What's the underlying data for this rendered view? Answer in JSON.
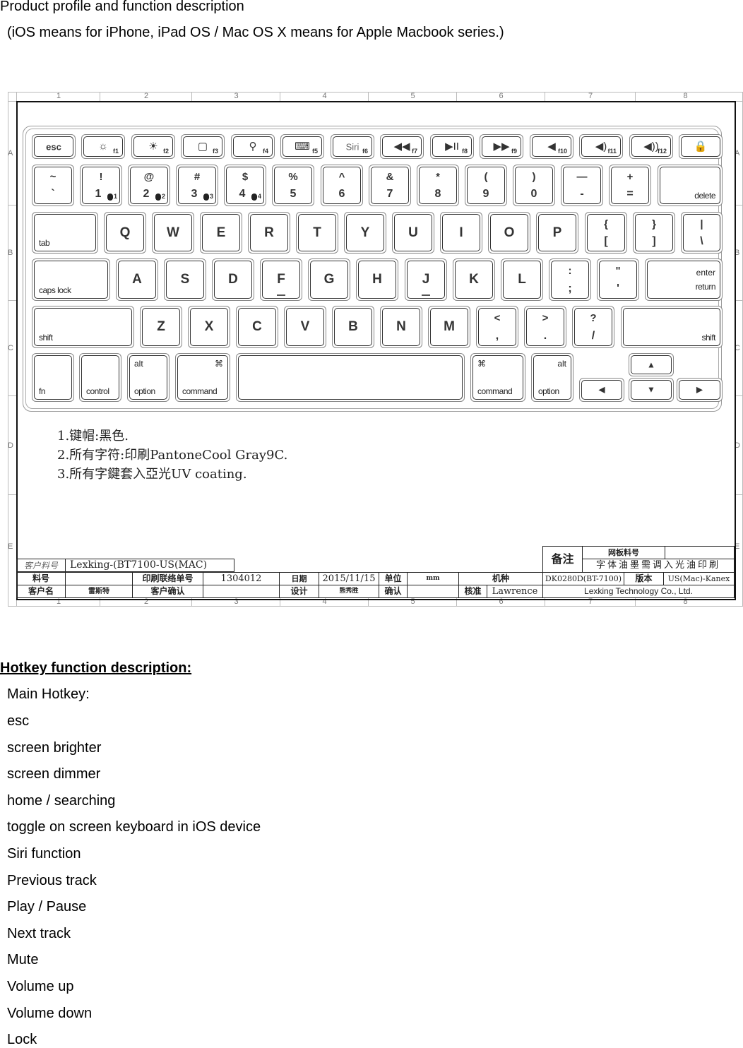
{
  "header": {
    "title": "Product profile and function description",
    "subtitle": "(iOS means for iPhone, iPad OS / Mac OS X means for Apple Macbook series.)"
  },
  "drawing": {
    "ruler_columns": [
      "1",
      "2",
      "3",
      "4",
      "5",
      "6",
      "7",
      "8"
    ],
    "ruler_rows": [
      "A",
      "B",
      "C",
      "D",
      "E"
    ],
    "keyboard": {
      "row1": [
        {
          "label": "esc"
        },
        {
          "icon": "brightness-down-icon",
          "glyph": "☼",
          "fn": "f1"
        },
        {
          "icon": "brightness-up-icon",
          "glyph": "☀",
          "fn": "f2"
        },
        {
          "icon": "home-square-icon",
          "glyph": "▢",
          "fn": "f3"
        },
        {
          "icon": "search-icon",
          "glyph": "⚲",
          "fn": "f4"
        },
        {
          "icon": "keyboard-icon",
          "glyph": "⌨",
          "fn": "f5"
        },
        {
          "label": "Siri",
          "fn": "f6"
        },
        {
          "icon": "previous-track-icon",
          "glyph": "◀◀",
          "fn": "f7"
        },
        {
          "icon": "play-pause-icon",
          "glyph": "▶II",
          "fn": "f8"
        },
        {
          "icon": "next-track-icon",
          "glyph": "▶▶",
          "fn": "f9"
        },
        {
          "icon": "mute-icon",
          "glyph": "◀",
          "fn": "f10"
        },
        {
          "icon": "volume-down-icon",
          "glyph": "◀)",
          "fn": "f11"
        },
        {
          "icon": "volume-up-icon",
          "glyph": "◀))",
          "fn": "f12"
        },
        {
          "icon": "lock-icon",
          "glyph": "🔒"
        }
      ],
      "row2": [
        {
          "top": "~",
          "bot": "`"
        },
        {
          "top": "!",
          "bot": "1",
          "badge": "1"
        },
        {
          "top": "@",
          "bot": "2",
          "badge": "2"
        },
        {
          "top": "#",
          "bot": "3",
          "badge": "3"
        },
        {
          "top": "$",
          "bot": "4",
          "badge": "4"
        },
        {
          "top": "%",
          "bot": "5"
        },
        {
          "top": "^",
          "bot": "6"
        },
        {
          "top": "&",
          "bot": "7"
        },
        {
          "top": "*",
          "bot": "8"
        },
        {
          "top": "(",
          "bot": "9"
        },
        {
          "top": ")",
          "bot": "0"
        },
        {
          "top": "—",
          "bot": "-"
        },
        {
          "top": "+",
          "bot": "="
        },
        {
          "br": "delete"
        }
      ],
      "row3": [
        {
          "bl": "tab"
        },
        {
          "c": "Q"
        },
        {
          "c": "W"
        },
        {
          "c": "E"
        },
        {
          "c": "R"
        },
        {
          "c": "T"
        },
        {
          "c": "Y"
        },
        {
          "c": "U"
        },
        {
          "c": "I"
        },
        {
          "c": "O"
        },
        {
          "c": "P"
        },
        {
          "top": "{",
          "bot": "["
        },
        {
          "top": "}",
          "bot": "]"
        },
        {
          "top": "|",
          "bot": "\\"
        }
      ],
      "row4": [
        {
          "bl": "caps lock"
        },
        {
          "c": "A"
        },
        {
          "c": "S"
        },
        {
          "c": "D"
        },
        {
          "c": "F",
          "home": true
        },
        {
          "c": "G"
        },
        {
          "c": "H"
        },
        {
          "c": "J",
          "home": true
        },
        {
          "c": "K"
        },
        {
          "c": "L"
        },
        {
          "top": ":",
          "bot": ";"
        },
        {
          "top": "\"",
          "bot": "'"
        },
        {
          "tr2": "enter",
          "br": "return"
        }
      ],
      "row5": [
        {
          "bl": "shift"
        },
        {
          "c": "Z"
        },
        {
          "c": "X"
        },
        {
          "c": "C"
        },
        {
          "c": "V"
        },
        {
          "c": "B"
        },
        {
          "c": "N"
        },
        {
          "c": "M"
        },
        {
          "top": "<",
          "bot": ","
        },
        {
          "top": ">",
          "bot": "."
        },
        {
          "top": "?",
          "bot": "/"
        },
        {
          "br": "shift"
        }
      ],
      "row6": [
        {
          "bl": "fn"
        },
        {
          "bl": "control"
        },
        {
          "tl": "alt",
          "bl": "option"
        },
        {
          "tr": "⌘",
          "bl": "command"
        },
        {
          "space": true
        },
        {
          "tl": "⌘",
          "bl": "command"
        },
        {
          "tr": "alt",
          "bl": "option"
        },
        {
          "icon": "arrow-left-icon",
          "glyph": "◀"
        },
        {
          "icon": "arrow-up-icon",
          "glyph": "▲"
        },
        {
          "icon": "arrow-down-icon",
          "glyph": "▼"
        },
        {
          "icon": "arrow-right-icon",
          "glyph": "▶"
        }
      ]
    },
    "notes": [
      "1.键帽:黑色.",
      "2.所有字符:印刷PantoneCool Gray9C.",
      "3.所有字鍵套入亞光UV coating."
    ],
    "title_block": {
      "customer_part_label": "客户料号",
      "customer_part_value": "Lexking-(BT7100-US(MAC)",
      "part_no_label": "料号",
      "part_no_value": "",
      "print_order_label": "印刷联络单号",
      "print_order_value": "1304012",
      "date_label": "日期",
      "date_value": "2015/11/15",
      "unit_label": "单位",
      "unit_value": "mm",
      "model_label": "机种",
      "model_value": "DK0280D(BT-7100)",
      "version_label": "版本",
      "version_value": "US(Mac)-Kanex",
      "customer_name_label": "客户名",
      "customer_name_value": "雷斯特",
      "customer_confirm_label": "客户确认",
      "customer_confirm_value": "",
      "design_label": "设计",
      "design_value": "熊秀胜",
      "confirm_label": "确认",
      "confirm_value": "",
      "approve_label": "核准",
      "approve_value": "Lawrence",
      "remarks_label": "备注",
      "screen_part_label": "网板料号",
      "screen_part_value": "",
      "remarks_value": "字体油墨需调入光油印刷",
      "company": "Lexking Technology Co., Ltd."
    }
  },
  "hotkeys": {
    "title": "Hotkey function description:",
    "heading": "Main Hotkey:",
    "items": [
      "esc",
      "screen brighter",
      "screen dimmer",
      "home / searching",
      "toggle on screen keyboard in iOS device",
      "Siri function",
      "Previous track",
      "Play / Pause",
      "Next track",
      "Mute",
      "Volume up",
      "Volume down",
      "Lock"
    ]
  }
}
